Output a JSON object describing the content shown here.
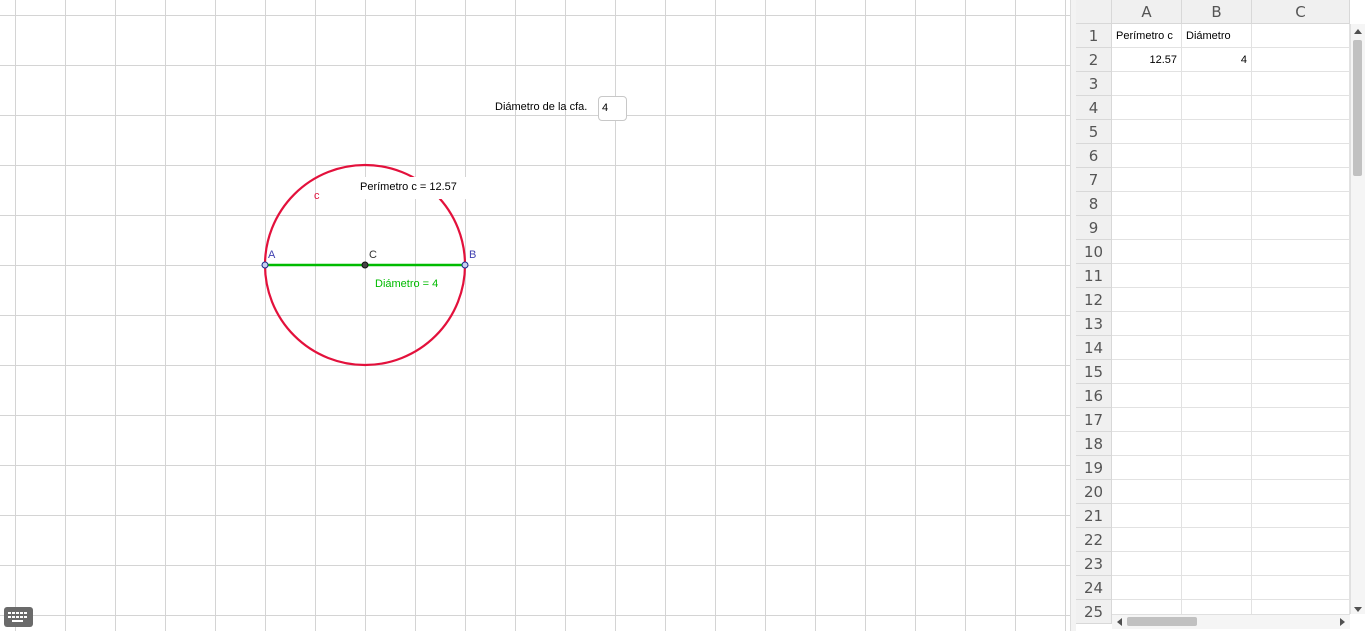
{
  "graphics": {
    "input": {
      "label": "Diámetro de la cfa.",
      "value": "4"
    },
    "circle": {
      "name": "c",
      "color": "#e3113c"
    },
    "perimeter_label": "Perímetro c = 12.57",
    "diameter_label": "Diámetro = 4",
    "diameter_color": "#00bb00",
    "points": {
      "a": "A",
      "b": "B",
      "center": "C"
    },
    "point_color": "#4040b0",
    "keyboard_icon": "keyboard-icon"
  },
  "spreadsheet": {
    "columns": [
      "A",
      "B",
      "C"
    ],
    "rows": [
      "1",
      "2",
      "3",
      "4",
      "5",
      "6",
      "7",
      "8",
      "9",
      "10",
      "11",
      "12",
      "13",
      "14",
      "15",
      "16",
      "17",
      "18",
      "19",
      "20",
      "21",
      "22",
      "23",
      "24",
      "25"
    ],
    "cells": {
      "A1": "Perímetro c",
      "B1": "Diámetro",
      "A2": "12.57",
      "B2": "4"
    }
  }
}
